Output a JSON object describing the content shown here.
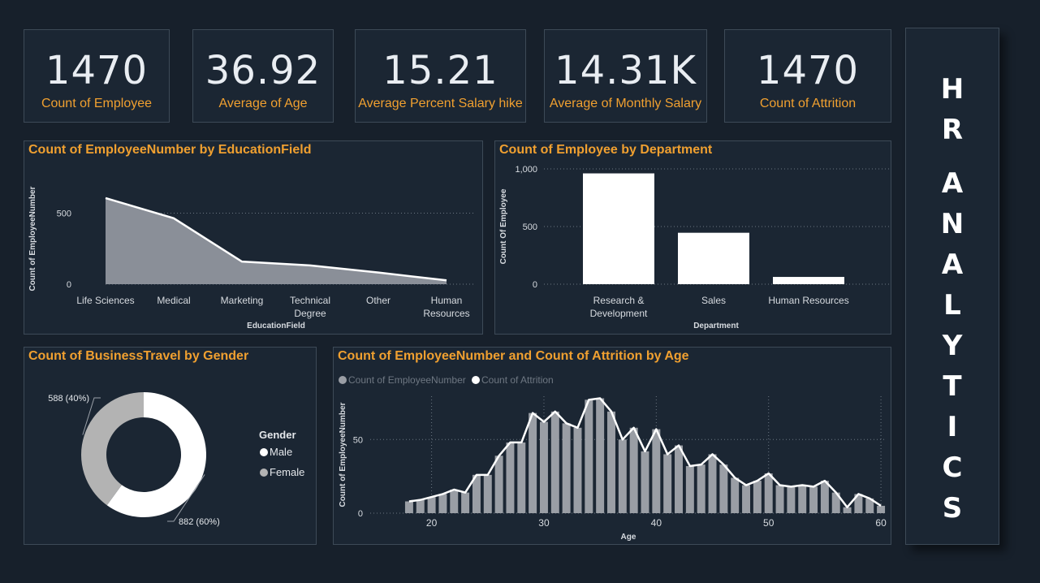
{
  "kpis": [
    {
      "value": "1470",
      "label": "Count of Employee"
    },
    {
      "value": "36.92",
      "label": "Average of Age"
    },
    {
      "value": "15.21",
      "label": "Average Percent Salary hike"
    },
    {
      "value": "14.31K",
      "label": "Average of Monthly Salary"
    },
    {
      "value": "1470",
      "label": "Count of Attrition"
    }
  ],
  "hr_title": [
    "H",
    "R",
    "A",
    "N",
    "A",
    "L",
    "Y",
    "T",
    "I",
    "C",
    "S"
  ],
  "colors": {
    "background": "#17202b",
    "panel": "#1b2633",
    "accent": "#f0a030",
    "area": "#8a8f98",
    "bar": "#ffffff"
  },
  "chart_data": [
    {
      "type": "area",
      "title": "Count of EmployeeNumber by EducationField",
      "xlabel": "EducationField",
      "ylabel": "Count of EmployeeNumber",
      "categories": [
        "Life Sciences",
        "Medical",
        "Marketing",
        "Technical Degree",
        "Other",
        "Human Resources"
      ],
      "category_lines": [
        [
          "Life Sciences"
        ],
        [
          "Medical"
        ],
        [
          "Marketing"
        ],
        [
          "Technical",
          "Degree"
        ],
        [
          "Other"
        ],
        [
          "Human",
          "Resources"
        ]
      ],
      "values": [
        606,
        464,
        159,
        132,
        82,
        27
      ],
      "yticks": [
        0,
        500
      ],
      "ytick_labels": [
        "0",
        "500"
      ],
      "ylim": [
        0,
        720
      ],
      "grid": true
    },
    {
      "type": "bar",
      "title": "Count of Employee by Department",
      "xlabel": "Department",
      "ylabel": "Count Of Employee",
      "categories": [
        "Research & Development",
        "Sales",
        "Human Resources"
      ],
      "category_lines": [
        [
          "Research &",
          "Development"
        ],
        [
          "Sales"
        ],
        [
          "Human Resources"
        ]
      ],
      "values": [
        961,
        446,
        63
      ],
      "yticks": [
        0,
        500,
        1000
      ],
      "ytick_labels": [
        "0",
        "500",
        "1,000"
      ],
      "ylim": [
        0,
        1000
      ],
      "grid": true
    },
    {
      "type": "pie",
      "title": "Count of BusinessTravel by Gender",
      "legend_title": "Gender",
      "slices": [
        {
          "name": "Male",
          "value": 882,
          "label": "882 (60%)",
          "color": "#ffffff"
        },
        {
          "name": "Female",
          "value": 588,
          "label": "588 (40%)",
          "color": "#b3b3b3"
        }
      ],
      "legend_position": "right"
    },
    {
      "type": "bar",
      "title": "Count of EmployeeNumber and Count of Attrition by Age",
      "xlabel": "Age",
      "ylabel": "Count of EmployeeNumber",
      "x": [
        18,
        19,
        20,
        21,
        22,
        23,
        24,
        25,
        26,
        27,
        28,
        29,
        30,
        31,
        32,
        33,
        34,
        35,
        36,
        37,
        38,
        39,
        40,
        41,
        42,
        43,
        44,
        45,
        46,
        47,
        48,
        49,
        50,
        51,
        52,
        53,
        54,
        55,
        56,
        57,
        58,
        59,
        60
      ],
      "series": [
        {
          "name": "Count of EmployeeNumber",
          "type": "bar",
          "color": "#9a9ea5",
          "values": [
            8,
            9,
            11,
            13,
            16,
            14,
            26,
            26,
            39,
            48,
            48,
            68,
            62,
            69,
            61,
            58,
            77,
            78,
            69,
            50,
            58,
            42,
            57,
            40,
            46,
            32,
            33,
            40,
            33,
            24,
            19,
            22,
            27,
            19,
            18,
            19,
            18,
            22,
            14,
            4,
            13,
            10,
            5
          ]
        },
        {
          "name": "Count of Attrition",
          "type": "line",
          "color": "#ffffff",
          "values": [
            8,
            9,
            11,
            13,
            16,
            14,
            26,
            26,
            39,
            48,
            48,
            68,
            62,
            69,
            61,
            58,
            77,
            78,
            69,
            50,
            58,
            42,
            57,
            40,
            46,
            32,
            33,
            40,
            33,
            24,
            19,
            22,
            27,
            19,
            18,
            19,
            18,
            22,
            14,
            4,
            13,
            10,
            5
          ]
        }
      ],
      "xticks": [
        20,
        30,
        40,
        50,
        60
      ],
      "yticks": [
        0,
        50
      ],
      "ylim": [
        0,
        86
      ],
      "legend_position": "top-left",
      "grid": true
    }
  ]
}
